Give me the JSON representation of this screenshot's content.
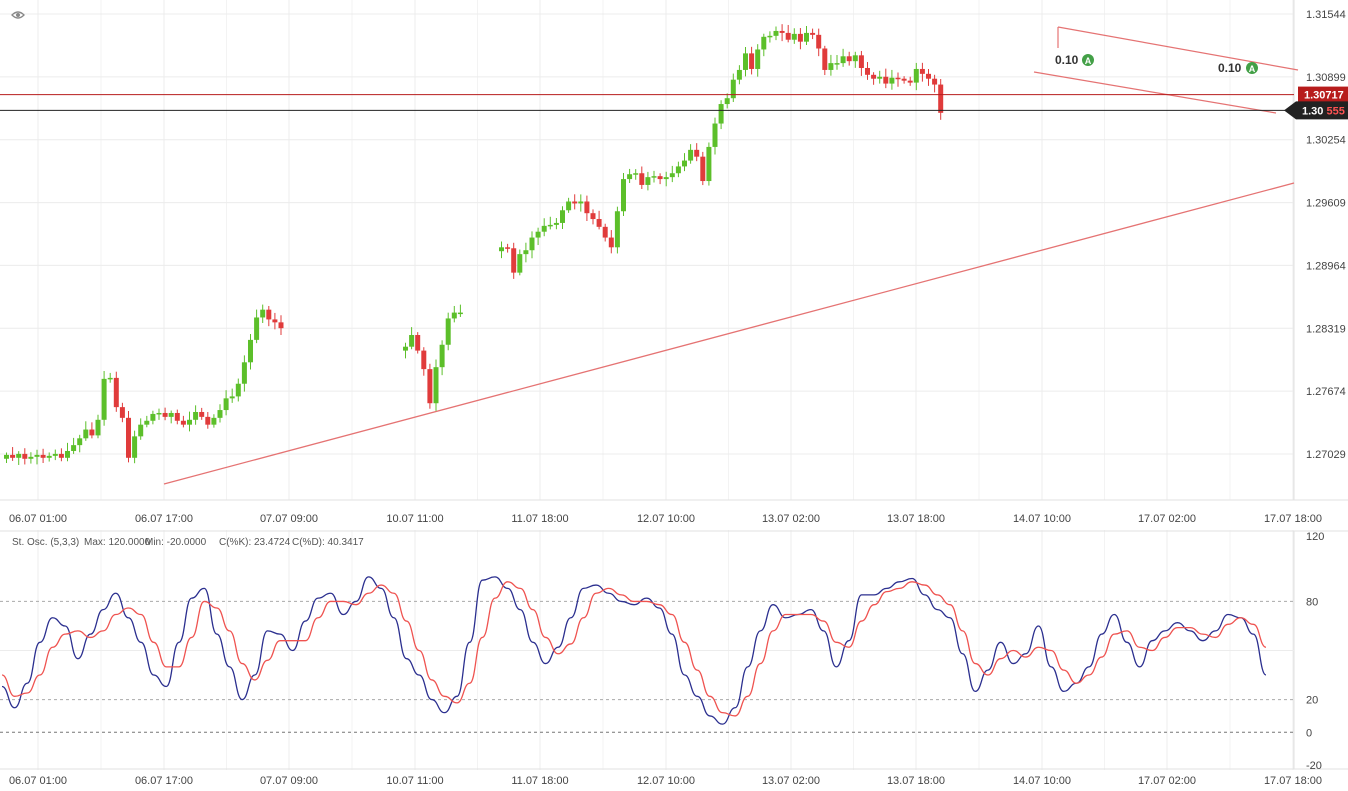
{
  "toolbar": {
    "visibility_icon": "eye-icon"
  },
  "chart_data": [
    {
      "type": "candlestick",
      "title": "",
      "ylim": [
        1.2655,
        1.3178
      ],
      "y_ticks": [
        "1.31544",
        "1.30899",
        "1.30254",
        "1.29609",
        "1.28964",
        "1.28319",
        "1.27674",
        "1.27029"
      ],
      "x_ticks": [
        "06.07 01:00",
        "06.07 17:00",
        "07.07 09:00",
        "10.07 11:00",
        "11.07 18:00",
        "12.07 10:00",
        "13.07 02:00",
        "13.07 18:00",
        "14.07 10:00",
        "17.07 02:00",
        "17.07 18:00"
      ],
      "price_lines": [
        {
          "label": "1.30717",
          "value": 1.30717,
          "color": "#b71c1c"
        },
        {
          "label_main": "1.30",
          "label_accent": "555",
          "value": 1.30555,
          "color": "#222222",
          "accent_color": "#ff5252"
        }
      ],
      "annotations": [
        {
          "text": "0.10",
          "marker": "A"
        },
        {
          "text": "0.10",
          "marker": "A"
        }
      ],
      "colors": {
        "up": "#5cbf2a",
        "down": "#e03b3b",
        "trendline": "#e57373"
      },
      "segments": [
        {
          "points": [
            1.2702,
            1.2699,
            1.2703,
            1.2698,
            1.27,
            1.2702,
            1.2699,
            1.2701,
            1.2703,
            1.2699,
            1.2706,
            1.2712,
            1.2719,
            1.2728,
            1.2722,
            1.2738,
            1.278,
            1.2781,
            1.2751,
            1.274,
            1.2699,
            1.2721,
            1.2733,
            1.2737,
            1.2744,
            1.2745,
            1.2741,
            1.2745,
            1.2737,
            1.2733,
            1.2738,
            1.2746,
            1.2741,
            1.2733,
            1.274,
            1.2748,
            1.276,
            1.2762,
            1.2775,
            1.2797,
            1.282,
            1.2843,
            1.2851,
            1.2841,
            1.2838,
            1.2832
          ]
        },
        {
          "points": [
            1.2813,
            1.2825,
            1.2809,
            1.279,
            1.2755,
            1.2792,
            1.2815,
            1.2842,
            1.2848,
            1.2848
          ]
        },
        {
          "points": [
            1.2915,
            1.2914,
            1.2889,
            1.2908,
            1.2912,
            1.2925,
            1.2931,
            1.2937,
            1.2938,
            1.294,
            1.2953,
            1.2962,
            1.296,
            1.2962,
            1.295,
            1.2944,
            1.2936,
            1.2925,
            1.2915,
            1.2952,
            1.2985,
            1.299,
            1.2991,
            1.2979,
            1.2987,
            1.2988,
            1.2985,
            1.2987,
            1.2991,
            1.2998,
            1.3004,
            1.3015,
            1.3008,
            1.2983,
            1.3018,
            1.3042,
            1.3062,
            1.3068,
            1.3087,
            1.3097,
            1.3114,
            1.3098,
            1.3118,
            1.3131,
            1.3132,
            1.3137,
            1.3135,
            1.3128,
            1.3134,
            1.3126,
            1.3135,
            1.3133,
            1.3119,
            1.3097,
            1.3104,
            1.3104,
            1.3111,
            1.3106,
            1.3112,
            1.3099,
            1.3092,
            1.3088,
            1.309,
            1.3083,
            1.3089,
            1.3088,
            1.3086,
            1.3084,
            1.3098,
            1.3093,
            1.3088,
            1.3082,
            1.3053
          ]
        }
      ]
    },
    {
      "type": "line",
      "title": "St. Osc. (5,3,3)",
      "stats": {
        "max": "Max: 120.0000",
        "min": "Min: -20.0000",
        "k": "C(%K): 23.4724",
        "d": "C(%D): 40.3417"
      },
      "ylim": [
        -20,
        120
      ],
      "y_ticks": [
        120,
        80,
        20,
        0,
        -20
      ],
      "levels": [
        80,
        20,
        0
      ],
      "series": [
        {
          "name": "%K",
          "color": "#2b2f8f",
          "values": [
            28,
            15,
            30,
            55,
            70,
            65,
            45,
            60,
            75,
            85,
            70,
            55,
            35,
            28,
            55,
            82,
            88,
            60,
            40,
            20,
            35,
            62,
            60,
            50,
            68,
            82,
            85,
            72,
            80,
            95,
            88,
            70,
            45,
            35,
            20,
            12,
            22,
            55,
            93,
            95,
            88,
            75,
            55,
            42,
            52,
            70,
            88,
            90,
            85,
            80,
            78,
            82,
            76,
            60,
            35,
            22,
            10,
            5,
            15,
            40,
            62,
            78,
            70,
            72,
            75,
            62,
            40,
            56,
            84,
            84,
            88,
            92,
            94,
            84,
            75,
            70,
            48,
            25,
            38,
            55,
            42,
            48,
            65,
            40,
            25,
            30,
            40,
            60,
            72,
            55,
            40,
            56,
            62,
            67,
            62,
            56,
            62,
            72,
            70,
            60,
            35
          ]
        },
        {
          "name": "%D",
          "color": "#ef5350",
          "values": [
            35,
            22,
            24,
            35,
            52,
            60,
            62,
            58,
            62,
            72,
            76,
            72,
            55,
            40,
            40,
            58,
            80,
            76,
            62,
            42,
            32,
            44,
            56,
            56,
            56,
            70,
            80,
            80,
            78,
            85,
            90,
            85,
            68,
            50,
            32,
            22,
            18,
            30,
            58,
            82,
            92,
            88,
            75,
            58,
            48,
            54,
            70,
            85,
            88,
            84,
            80,
            80,
            78,
            72,
            55,
            38,
            22,
            12,
            10,
            22,
            42,
            62,
            72,
            72,
            72,
            68,
            55,
            52,
            68,
            78,
            86,
            88,
            92,
            90,
            84,
            78,
            62,
            42,
            35,
            45,
            50,
            46,
            52,
            50,
            38,
            30,
            35,
            46,
            60,
            62,
            52,
            50,
            58,
            64,
            64,
            60,
            58,
            66,
            70,
            66,
            52
          ]
        }
      ],
      "x_ticks": [
        "06.07 01:00",
        "06.07 17:00",
        "07.07 09:00",
        "10.07 11:00",
        "11.07 18:00",
        "12.07 10:00",
        "13.07 02:00",
        "13.07 18:00",
        "14.07 10:00",
        "17.07 02:00",
        "17.07 18:00"
      ]
    }
  ]
}
